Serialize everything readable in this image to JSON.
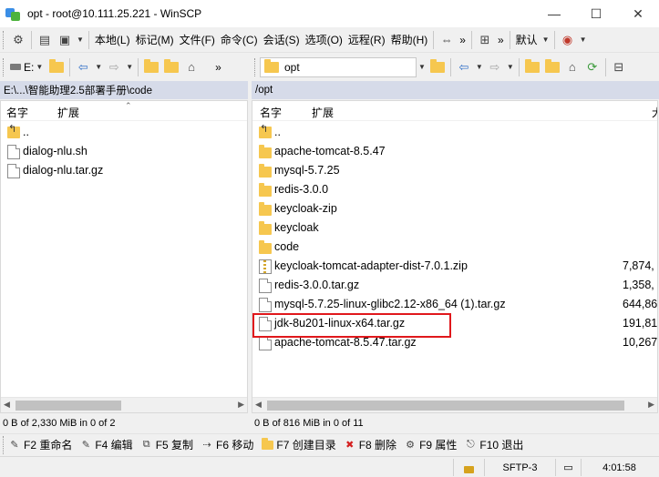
{
  "window": {
    "title": "opt - root@10.111.25.221 - WinSCP",
    "minimize_glyph": "—",
    "maximize_glyph": "☐",
    "close_glyph": "✕"
  },
  "menubar": {
    "items": [
      "本地(L)",
      "标记(M)",
      "文件(F)",
      "命令(C)",
      "会话(S)",
      "选项(O)",
      "远程(R)",
      "帮助(H)"
    ],
    "transfer_preset": "默认",
    "more": "»"
  },
  "left_toolbar": {
    "drive": "E:",
    "more": "»"
  },
  "right_toolbar": {
    "folder": "opt"
  },
  "left_panel": {
    "path": "E:\\...\\智能助理2.5部署手册\\code",
    "columns": {
      "name": "名字",
      "ext": "扩展"
    },
    "files": [
      {
        "name": "..",
        "type": "up"
      },
      {
        "name": "dialog-nlu.sh",
        "type": "file"
      },
      {
        "name": "dialog-nlu.tar.gz",
        "type": "file"
      }
    ],
    "status": "0 B of 2,330 MiB in 0 of 2"
  },
  "right_panel": {
    "path": "/opt",
    "columns": {
      "name": "名字",
      "ext": "扩展",
      "size": "大"
    },
    "files": [
      {
        "name": "..",
        "type": "up",
        "size": ""
      },
      {
        "name": "apache-tomcat-8.5.47",
        "type": "folder",
        "size": ""
      },
      {
        "name": "mysql-5.7.25",
        "type": "folder",
        "size": ""
      },
      {
        "name": "redis-3.0.0",
        "type": "folder",
        "size": ""
      },
      {
        "name": "keycloak-zip",
        "type": "folder",
        "size": ""
      },
      {
        "name": "keycloak",
        "type": "folder",
        "size": ""
      },
      {
        "name": "code",
        "type": "folder",
        "size": ""
      },
      {
        "name": "keycloak-tomcat-adapter-dist-7.0.1.zip",
        "type": "zip",
        "size": "7,874,"
      },
      {
        "name": "redis-3.0.0.tar.gz",
        "type": "file",
        "size": "1,358,"
      },
      {
        "name": "mysql-5.7.25-linux-glibc2.12-x86_64 (1).tar.gz",
        "type": "file",
        "size": "644,86"
      },
      {
        "name": "jdk-8u201-linux-x64.tar.gz",
        "type": "file",
        "size": "191,81"
      },
      {
        "name": "apache-tomcat-8.5.47.tar.gz",
        "type": "file",
        "size": "10,267"
      }
    ],
    "highlighted_file": "jdk-8u201-linux-x64.tar.gz",
    "status": "0 B of 816 MiB in 0 of 11"
  },
  "fkeys": [
    {
      "label": "F2 重命名",
      "icon": "rename-icon",
      "glyph": "✎"
    },
    {
      "label": "F4 编辑",
      "icon": "edit-icon",
      "glyph": "📝"
    },
    {
      "label": "F5 复制",
      "icon": "copy-icon",
      "glyph": "⧉"
    },
    {
      "label": "F6 移动",
      "icon": "move-icon",
      "glyph": "⇢"
    },
    {
      "label": "F7 创建目录",
      "icon": "new-folder-icon",
      "glyph": "✚"
    },
    {
      "label": "F8 删除",
      "icon": "delete-icon",
      "glyph": "✖"
    },
    {
      "label": "F9 属性",
      "icon": "properties-icon",
      "glyph": "⚙"
    },
    {
      "label": "F10 退出",
      "icon": "exit-icon",
      "glyph": "⎋"
    }
  ],
  "statusbar": {
    "protocol": "SFTP-3",
    "time": "4:01:58"
  },
  "colors": {
    "pathbar": "#d6dbe9",
    "highlight": "#e0181c",
    "folder": "#f6c74f",
    "fkey_delete": "#d42020"
  }
}
